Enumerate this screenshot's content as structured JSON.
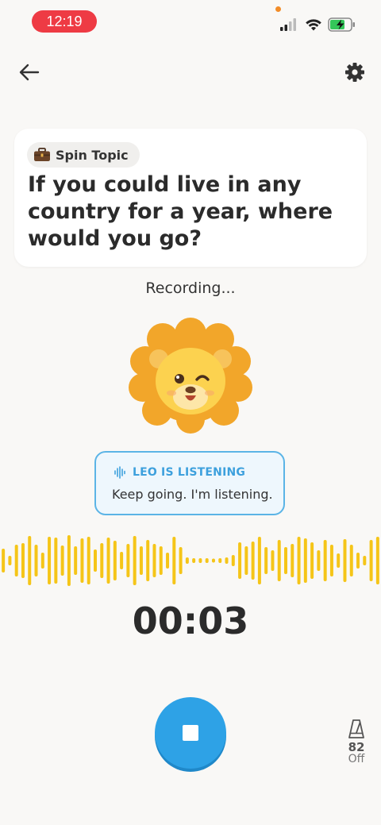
{
  "status_bar": {
    "time": "12:19"
  },
  "icons": {
    "back": "arrow-left-icon",
    "settings": "gear-icon",
    "topic": "briefcase-icon",
    "listening": "soundwave-icon",
    "stop": "stop-icon",
    "metronome": "metronome-icon"
  },
  "topic": {
    "badge_label": "Spin Topic",
    "question": "If you could live in any country for a year, where would you go?"
  },
  "recording": {
    "status": "Recording...",
    "timer": "00:03"
  },
  "listening_bubble": {
    "title": "LEO IS LISTENING",
    "message": "Keep going. I'm listening."
  },
  "metronome": {
    "bpm": "82",
    "state": "Off"
  },
  "colors": {
    "accent_blue": "#2ea2e6",
    "waveform_yellow": "#f5c518",
    "lion_orange": "#f2a62a",
    "time_pill_red": "#ee3b44"
  }
}
